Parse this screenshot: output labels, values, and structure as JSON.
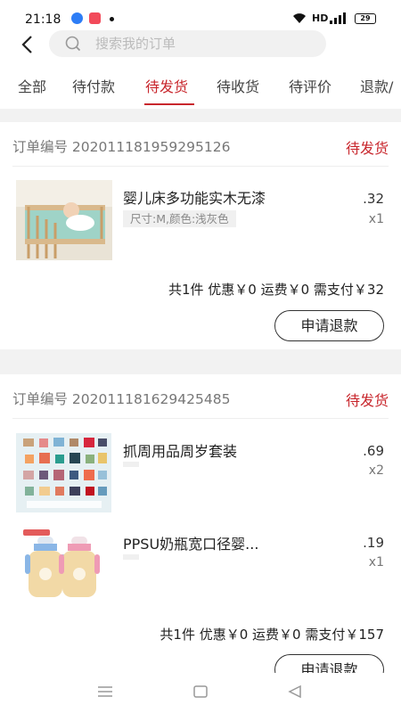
{
  "status_bar": {
    "time": "21:18",
    "network": "HD",
    "battery": "29"
  },
  "search": {
    "placeholder": "搜索我的订单"
  },
  "tabs": [
    {
      "label": "全部",
      "active": false
    },
    {
      "label": "待付款",
      "active": false
    },
    {
      "label": "待发货",
      "active": true
    },
    {
      "label": "待收货",
      "active": false
    },
    {
      "label": "待评价",
      "active": false
    },
    {
      "label": "退款/",
      "active": false
    }
  ],
  "orders": [
    {
      "order_no": "订单编号 202011181959295126",
      "status": "待发货",
      "items": [
        {
          "name": "婴儿床多功能实木无漆",
          "spec": "尺寸:M,颜色:浅灰色",
          "price": ".32",
          "qty": "x1"
        }
      ],
      "summary": "共1件  优惠￥0  运费￥0  需支付￥32",
      "refund_label": "申请退款"
    },
    {
      "order_no": "订单编号 202011181629425485",
      "status": "待发货",
      "items": [
        {
          "name": "抓周用品周岁套装",
          "spec": "",
          "price": ".69",
          "qty": "x2"
        },
        {
          "name": "PPSU奶瓶宽口径婴...",
          "spec": "",
          "price": ".19",
          "qty": "x1"
        }
      ],
      "summary": "共1件  优惠￥0  运费￥0  需支付￥157",
      "refund_label": "申请退款"
    }
  ],
  "colors": {
    "accent": "#c8262c",
    "background": "#f2f2f2"
  },
  "icons": [
    "back-arrow-icon",
    "search-icon",
    "menu-icon",
    "home-icon",
    "back-triangle-icon"
  ]
}
